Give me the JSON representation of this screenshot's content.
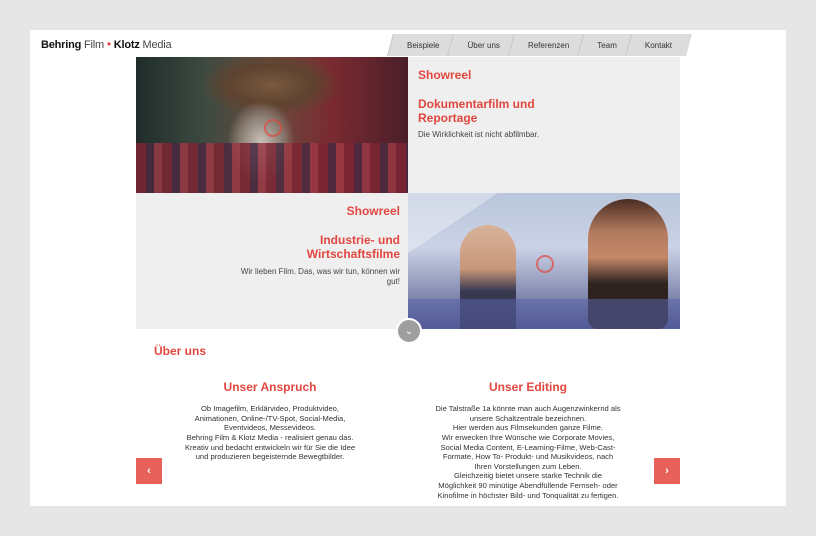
{
  "header": {
    "logo": {
      "part1": "Behring",
      "part2": "Film",
      "dot": "•",
      "part3": "Klotz",
      "part4": "Media"
    },
    "nav": [
      "Beispiele",
      "Über uns",
      "Referenzen",
      "Team",
      "Kontakt"
    ]
  },
  "hero": {
    "tile1": {
      "heading": "Showreel",
      "title": "Dokumentarfilm und Reportage",
      "description": "Die Wirklichkeit ist nicht abfilmbar."
    },
    "tile2": {
      "heading": "Showreel",
      "title": "Industrie- und Wirtschaftsfilme",
      "description": "Wir lieben Film. Das, was wir tun, können wir gut!"
    }
  },
  "icons": {
    "scroll_down": "chevron-down-icon",
    "prev": "chevron-left-icon",
    "next": "chevron-right-icon"
  },
  "glyphs": {
    "down": "⌄",
    "prev": "‹",
    "next": "›"
  },
  "about": {
    "title": "Über uns",
    "columns": [
      {
        "title": "Unser Anspruch",
        "lines": [
          "Ob Imagefilm, Erklärvideo, Produktvideo,",
          "Animationen, Online-/TV-Spot, Social-Media,",
          "Eventvideos, Messevideos.",
          "Behring Film & Klotz Media - realisiert genau das.",
          "Kreativ und bedacht entwickeln wir für Sie die Idee",
          "und produzieren begeisternde Bewegtbilder."
        ]
      },
      {
        "title": "Unser Editing",
        "lines": [
          "Die Talstraße 1a könnte man auch Augenzwinkernd als",
          "unsere Schaltzentrale bezeichnen.",
          "Hier werden aus Filmsekunden ganze Filme.",
          "Wir erwecken Ihre Wünsche wie Corporate Movies,",
          "Social Media Content, E-Learning-Filme, Web-Cast-",
          "Formate, How To- Produkt- und Musikvideos, nach",
          "Ihren Vorstellungen zum Leben.",
          "Gleichzeitig bietet unsere starke Technik die",
          "Möglichkeit 90 minütige Abendfüllende Fernseh- oder",
          "Kinofilme in höchster Bild- und Tonqualität zu fertigen."
        ]
      }
    ]
  },
  "colors": {
    "accent": "#e2473f",
    "arrow": "#e8605a"
  }
}
